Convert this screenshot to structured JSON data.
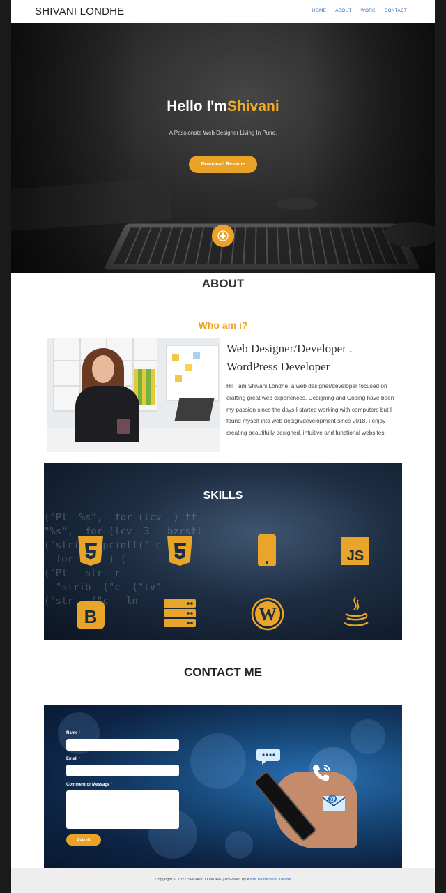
{
  "header": {
    "logo": "SHIVANI LONDHE",
    "nav": [
      "HOME",
      "ABOUT",
      "WORK",
      "CONTACT"
    ]
  },
  "hero": {
    "greeting": "Hello I'm",
    "name": "Shivani",
    "subtitle": "A Passionate Web Designer Living In Pune.",
    "button": "Download Resume"
  },
  "about": {
    "heading": "ABOUT",
    "subheading": "Who am i?",
    "role_line1": "Web Designer/Developer .",
    "role_line2": "WordPress Developer",
    "bio": "Hi! I am Shivani Londhe, a web designer/developer focused on crafting great web experiences. Designing and Coding have been my passion since the days I started working with computers but I found myself into web design/development since 2018. I enjoy creating beautifully designed, intuitive and functional websites."
  },
  "skills": {
    "heading": "SKILLS",
    "icons": [
      "html5-icon",
      "css3-icon",
      "mobile-icon",
      "javascript-icon",
      "bootstrap-icon",
      "server-icon",
      "wordpress-icon",
      "java-icon"
    ]
  },
  "contact": {
    "heading": "CONTACT ME",
    "name_label": "Name",
    "email_label": "Email",
    "message_label": "Comment or Message",
    "required_mark": "*",
    "submit": "Submit"
  },
  "footer": {
    "copyright": "Copyright © 2021 SHIVANI LONDHE | Powered by",
    "link": "Astra WordPress Theme"
  },
  "colors": {
    "accent": "#eaa326",
    "link": "#2a6fbd"
  }
}
